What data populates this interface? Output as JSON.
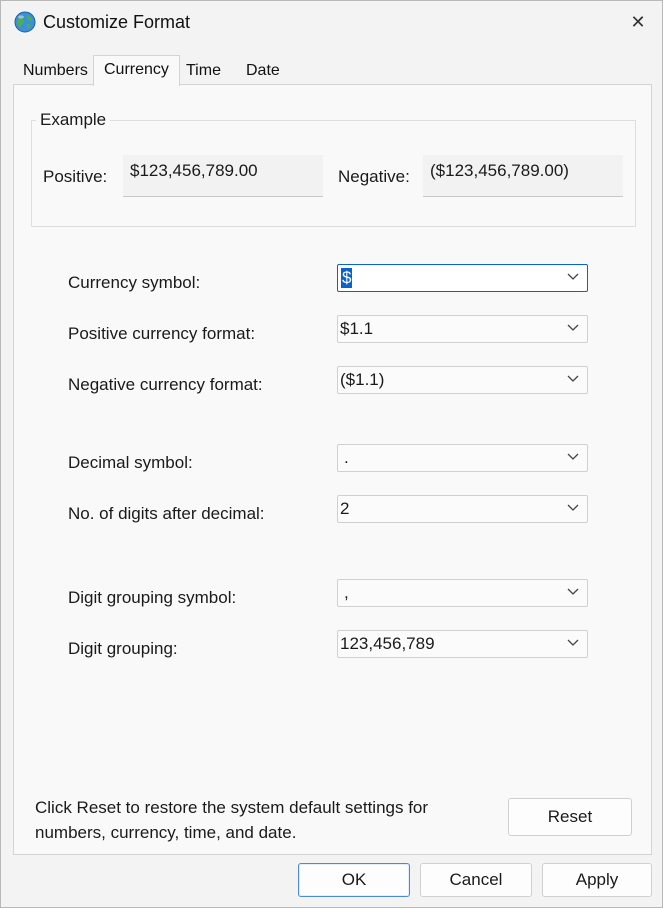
{
  "window": {
    "title": "Customize Format",
    "close_glyph": "✕"
  },
  "tabs": [
    {
      "label": "Numbers",
      "active": false
    },
    {
      "label": "Currency",
      "active": true
    },
    {
      "label": "Time",
      "active": false
    },
    {
      "label": "Date",
      "active": false
    }
  ],
  "example": {
    "legend": "Example",
    "positive_label": "Positive:",
    "positive_value": "$123,456,789.00",
    "negative_label": "Negative:",
    "negative_value": "($123,456,789.00)"
  },
  "settings": [
    {
      "label": "Currency symbol:",
      "value": "$",
      "focused": true
    },
    {
      "label": "Positive currency format:",
      "value": "$1.1"
    },
    {
      "label": "Negative currency format:",
      "value": "($1.1)"
    },
    {
      "label": "Decimal symbol:",
      "value": "."
    },
    {
      "label": "No. of digits after decimal:",
      "value": "2"
    },
    {
      "label": "Digit grouping symbol:",
      "value": ","
    },
    {
      "label": "Digit grouping:",
      "value": "123,456,789"
    }
  ],
  "footer": {
    "reset_text": "Click Reset to restore the system default settings for numbers, currency, time, and date.",
    "reset_button": "Reset"
  },
  "buttons": {
    "ok": "OK",
    "cancel": "Cancel",
    "apply": "Apply"
  },
  "colors": {
    "accent": "#0a64c8",
    "panel": "#f9f9f9",
    "window": "#f3f3f3"
  },
  "icons": {
    "app": "globe-icon",
    "dropdown": "chevron-down-icon",
    "close": "close-icon"
  }
}
